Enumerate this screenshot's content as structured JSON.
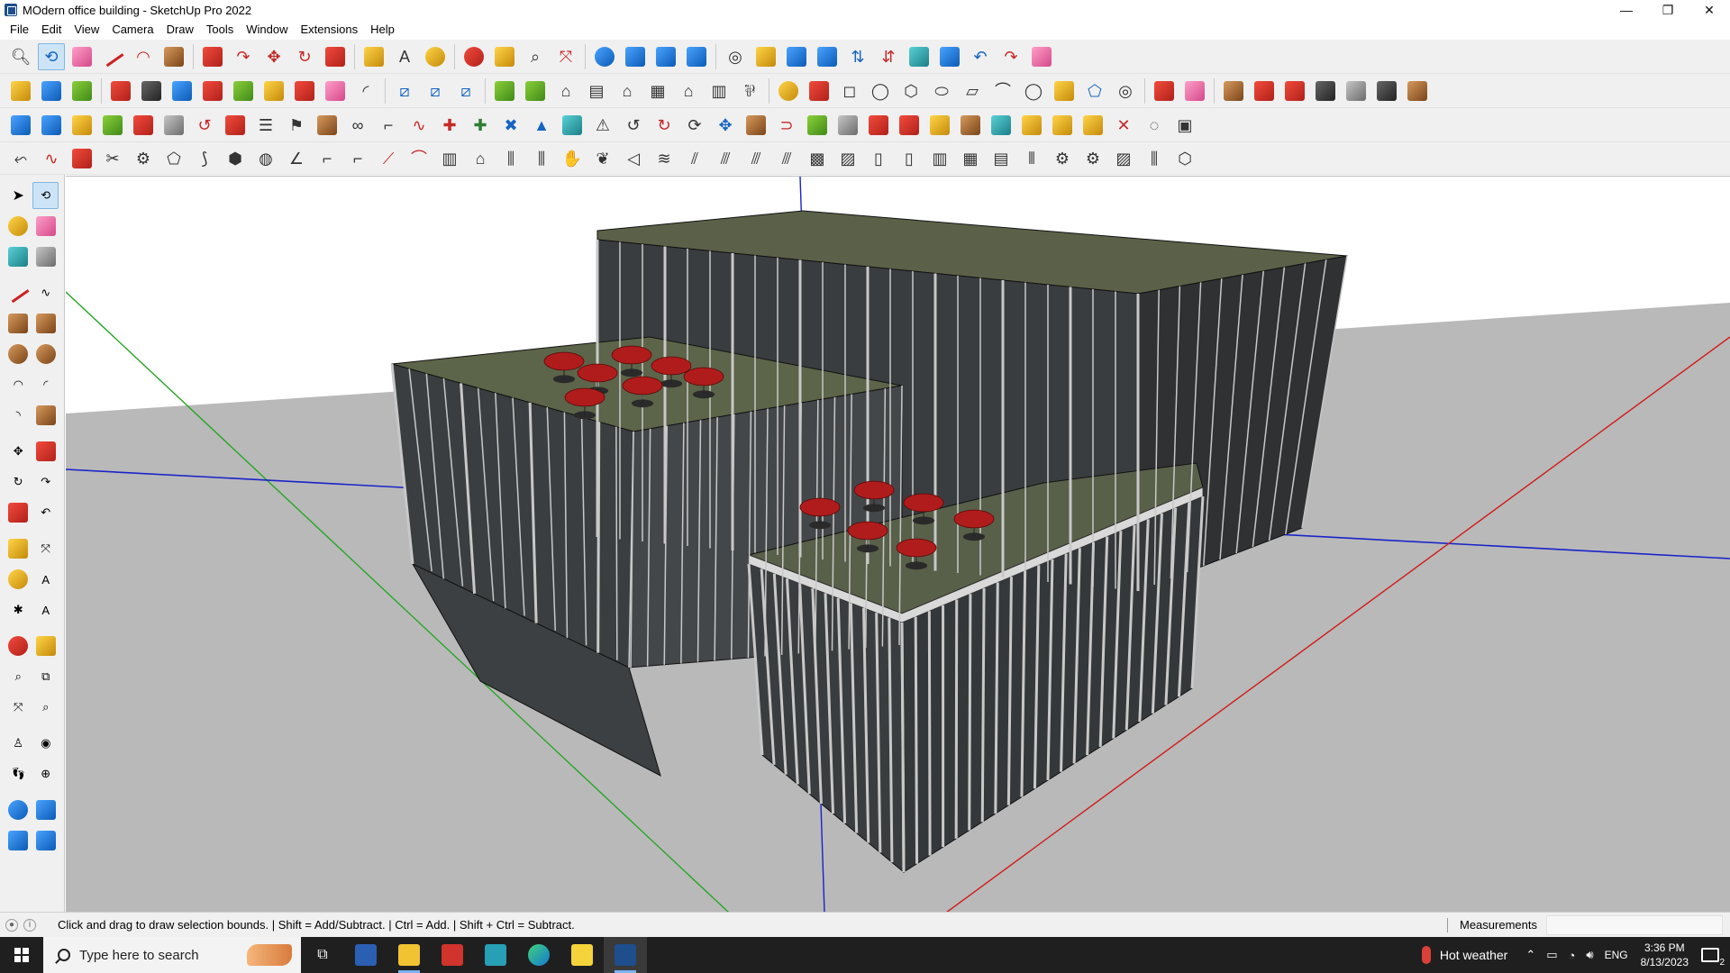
{
  "window": {
    "title": "MOdern office building - SketchUp Pro 2022",
    "controls": [
      "—",
      "❐",
      "✕"
    ]
  },
  "menu": [
    "File",
    "Edit",
    "View",
    "Camera",
    "Draw",
    "Tools",
    "Window",
    "Extensions",
    "Help"
  ],
  "status": {
    "hint": "Click and drag to draw selection bounds. | Shift = Add/Subtract. | Ctrl = Add. | Shift + Ctrl = Subtract.",
    "measurements_label": "Measurements",
    "measurements_value": ""
  },
  "taskbar": {
    "search_placeholder": "Type here to search",
    "weather": "Hot weather",
    "language": "ENG",
    "time": "3:36 PM",
    "date": "8/13/2023",
    "notifications": "2"
  },
  "colors": {
    "accent": "#1565c0",
    "axis_red": "#d11a1a",
    "axis_green": "#2aa52a",
    "axis_blue": "#1a22c8",
    "ground": "#b9b9b9",
    "roof": "#5a6248",
    "facade": "#3c3f41",
    "umbrella": "#b01c1c"
  }
}
